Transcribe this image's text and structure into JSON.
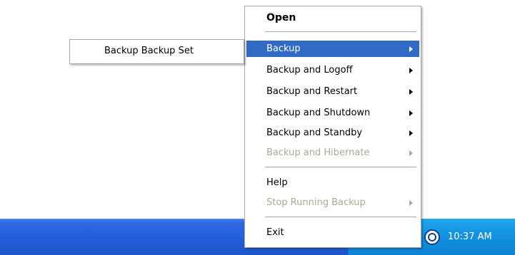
{
  "taskbar": {
    "clock": "10:37 AM",
    "tray_icon": "backup-tray-icon"
  },
  "context_menu": {
    "open_label": "Open",
    "backup_label": "Backup",
    "backup_logoff_label": "Backup and Logoff",
    "backup_restart_label": "Backup and Restart",
    "backup_shutdown_label": "Backup and Shutdown",
    "backup_standby_label": "Backup and Standby",
    "backup_hibernate_label": "Backup and Hibernate",
    "help_label": "Help",
    "stop_running_label": "Stop Running Backup",
    "exit_label": "Exit"
  },
  "submenu": {
    "backup_set_label": "Backup Backup Set"
  },
  "colors": {
    "selection": "#316ac5",
    "disabled_text": "#aca899",
    "taskbar": "#245edb",
    "tray": "#0f82d3"
  }
}
